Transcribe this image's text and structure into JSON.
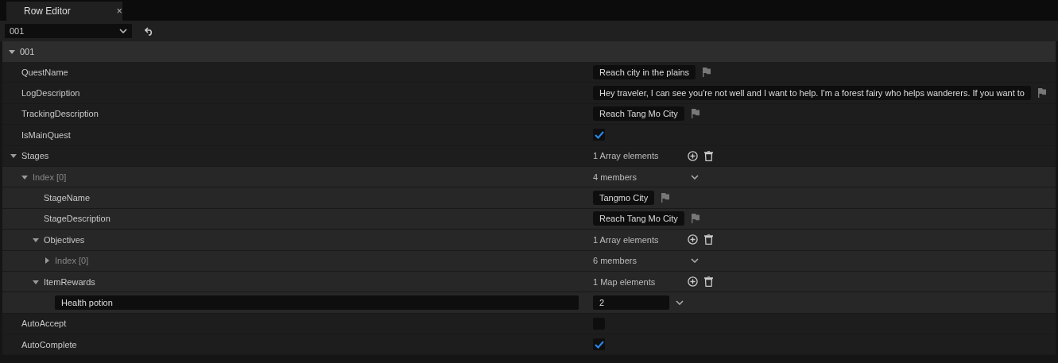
{
  "tab": {
    "title": "Row Editor",
    "close": "×"
  },
  "row_picker": {
    "value": "001"
  },
  "section": {
    "label": "001",
    "expanded": true,
    "properties": [
      {
        "kind": "text",
        "name": "QuestName",
        "value": "Reach city in the plains"
      },
      {
        "kind": "text",
        "name": "LogDescription",
        "value": "Hey traveler, I can see you're not well and I want to help. I'm a forest fairy who helps wanderers. If you want to"
      },
      {
        "kind": "text",
        "name": "TrackingDescription",
        "value": "Reach Tang Mo City"
      },
      {
        "kind": "bool",
        "name": "IsMainQuest",
        "checked": true
      },
      {
        "kind": "array",
        "name": "Stages",
        "expanded": true,
        "count": "1 Array elements",
        "children": [
          {
            "kind": "struct",
            "name": "Index [0]",
            "expanded": true,
            "count": "4 members",
            "children": [
              {
                "kind": "text",
                "name": "StageName",
                "value": "Tangmo City"
              },
              {
                "kind": "text",
                "name": "StageDescription",
                "value": "Reach Tang Mo City"
              },
              {
                "kind": "array",
                "name": "Objectives",
                "expanded": true,
                "count": "1 Array elements",
                "children": [
                  {
                    "kind": "struct",
                    "name": "Index [0]",
                    "expanded": false,
                    "count": "6 members"
                  }
                ]
              },
              {
                "kind": "map",
                "name": "ItemRewards",
                "expanded": true,
                "count": "1 Map elements",
                "entries": [
                  {
                    "key": "Health potion",
                    "value": "2"
                  }
                ]
              }
            ]
          }
        ]
      },
      {
        "kind": "bool",
        "name": "AutoAccept",
        "checked": false
      },
      {
        "kind": "bool",
        "name": "AutoComplete",
        "checked": true
      }
    ]
  }
}
